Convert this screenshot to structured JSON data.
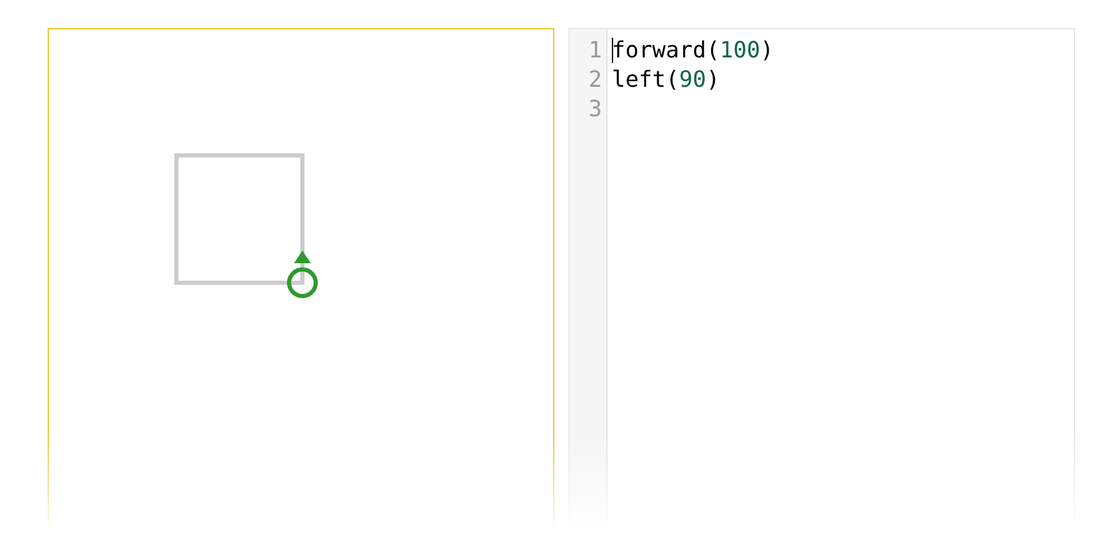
{
  "editor": {
    "lines": [
      {
        "number": "1",
        "has_cursor": true,
        "tokens": [
          {
            "kind": "name",
            "text": "forward"
          },
          {
            "kind": "punct",
            "text": "("
          },
          {
            "kind": "number",
            "text": "100"
          },
          {
            "kind": "punct",
            "text": ")"
          }
        ]
      },
      {
        "number": "2",
        "has_cursor": false,
        "tokens": [
          {
            "kind": "name",
            "text": "left"
          },
          {
            "kind": "punct",
            "text": "("
          },
          {
            "kind": "number",
            "text": "90"
          },
          {
            "kind": "punct",
            "text": ")"
          }
        ]
      },
      {
        "number": "3",
        "has_cursor": false
      }
    ]
  }
}
